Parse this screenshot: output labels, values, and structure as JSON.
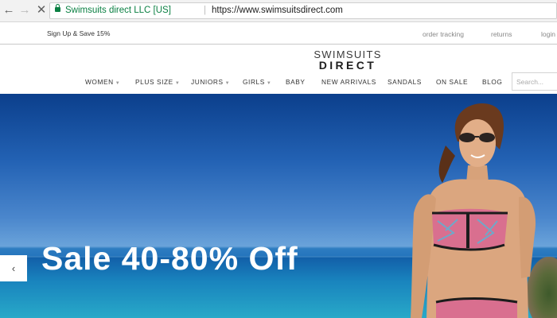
{
  "browser": {
    "secure_label": "Swimsuits direct LLC [US]",
    "separator": "|",
    "url": "https://www.swimsuitsdirect.com"
  },
  "utility": {
    "promo": "Sign Up & Save 15%",
    "links": [
      "order tracking",
      "returns",
      "login"
    ]
  },
  "logo": {
    "top": "SWIMSUITS",
    "bottom": "DIRECT"
  },
  "nav": [
    {
      "label": "WOMEN",
      "dropdown": true
    },
    {
      "label": "PLUS SIZE",
      "dropdown": true
    },
    {
      "label": "JUNIORS",
      "dropdown": true
    },
    {
      "label": "GIRLS",
      "dropdown": true
    },
    {
      "label": "BABY",
      "dropdown": false
    },
    {
      "label": "NEW ARRIVALS",
      "dropdown": false
    },
    {
      "label": "SANDALS",
      "dropdown": false
    },
    {
      "label": "ON SALE",
      "dropdown": false
    },
    {
      "label": "BLOG",
      "dropdown": false
    }
  ],
  "search": {
    "placeholder": "Search..."
  },
  "hero": {
    "headline": "Sale 40-80% Off"
  },
  "icons": {
    "back": "back-arrow-icon",
    "forward": "forward-arrow-icon",
    "reload": "stop-icon",
    "lock": "lock-icon",
    "prev": "chevron-left-icon"
  },
  "colors": {
    "secure_green": "#0b8043",
    "sky": "#2362b4",
    "sea": "#28a9c8"
  }
}
